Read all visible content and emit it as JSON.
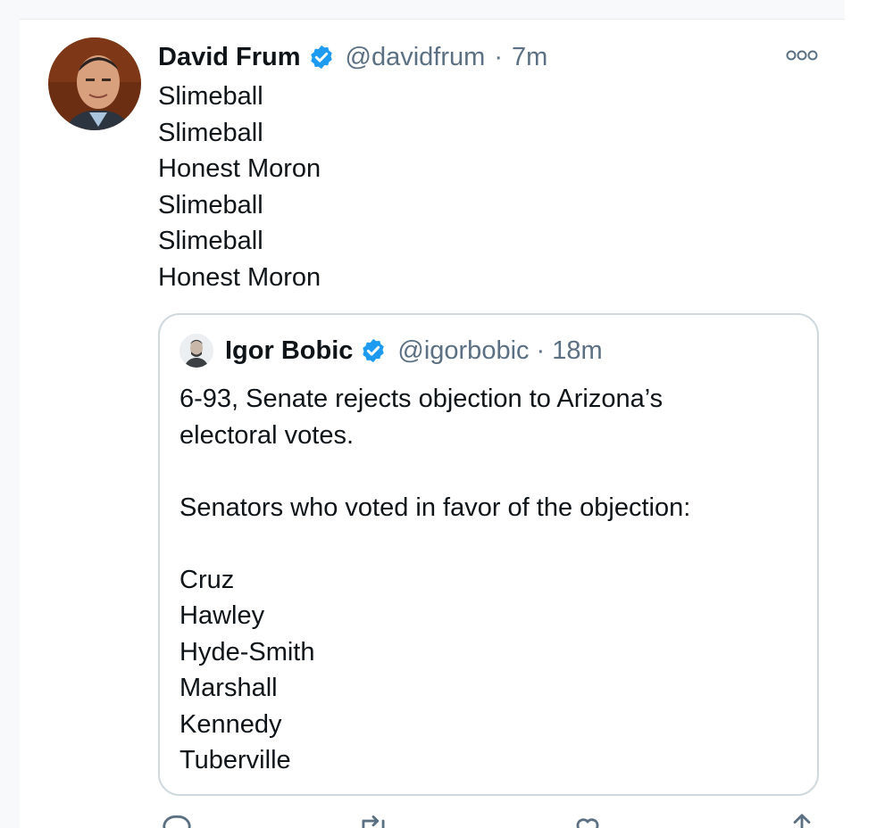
{
  "tweet": {
    "author": {
      "display_name": "David Frum",
      "handle": "@davidfrum",
      "verified": true
    },
    "separator": "·",
    "time": "7m",
    "body_lines": [
      "Slimeball",
      "Slimeball",
      "Honest Moron",
      "Slimeball",
      "Slimeball",
      "Honest Moron"
    ],
    "more_icon": "more-options-icon"
  },
  "quote": {
    "author": {
      "display_name": "Igor Bobic",
      "handle": "@igorbobic",
      "verified": true
    },
    "separator": "·",
    "time": "18m",
    "text_lines": [
      "6-93, Senate rejects objection to Arizona’s",
      "electoral votes.",
      "",
      "Senators who voted in favor of the objection:",
      "",
      "Cruz",
      "Hawley",
      "Hyde-Smith",
      "Marshall",
      "Kennedy",
      "Tuberville"
    ]
  },
  "actions": {
    "reply_icon": "reply-icon",
    "retweet_icon": "retweet-icon",
    "like_icon": "like-icon",
    "share_icon": "share-icon"
  },
  "colors": {
    "verified_blue": "#1d9bf0",
    "secondary_text": "#5b7083",
    "border": "#cfd9de"
  }
}
